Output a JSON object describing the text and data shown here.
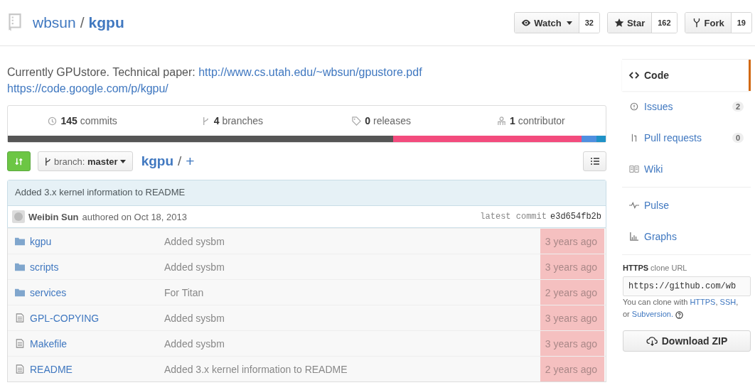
{
  "repo": {
    "owner": "wbsun",
    "separator": "/",
    "name": "kgpu"
  },
  "actions": [
    {
      "kind": "watch",
      "label": "Watch",
      "count": "32"
    },
    {
      "kind": "star",
      "label": "Star",
      "count": "162"
    },
    {
      "kind": "fork",
      "label": "Fork",
      "count": "19"
    }
  ],
  "description": {
    "text": "Currently GPUstore. Technical paper:",
    "link": "http://www.cs.utah.edu/~wbsun/gpustore.pdf",
    "homepage": "https://code.google.com/p/kgpu/"
  },
  "stats": [
    {
      "kind": "commits",
      "count": "145",
      "label": "commits"
    },
    {
      "kind": "branches",
      "count": "4",
      "label": "branches"
    },
    {
      "kind": "releases",
      "count": "0",
      "label": "releases"
    },
    {
      "kind": "contributors",
      "count": "1",
      "label": "contributor"
    }
  ],
  "languages": [
    {
      "color": "#555555"
    },
    {
      "color": "#f34b7d"
    },
    {
      "color": "#4f8fe0"
    },
    {
      "color": "#1f92c7"
    }
  ],
  "toolbar": {
    "branch_label": "branch:",
    "branch": "master",
    "path": "kgpu",
    "path_sep": "/",
    "add": "+"
  },
  "commit": {
    "message": "Added 3.x kernel information to README",
    "author": "Weibin Sun",
    "authored": "authored on Oct 18, 2013",
    "latest_label": "latest commit",
    "sha": "e3d654fb2b"
  },
  "files": {
    "age_highlighted": true,
    "rows": [
      {
        "kind": "folder",
        "name": "kgpu",
        "message": "Added sysbm",
        "age": "3 years ago"
      },
      {
        "kind": "folder",
        "name": "scripts",
        "message": "Added sysbm",
        "age": "3 years ago"
      },
      {
        "kind": "folder",
        "name": "services",
        "message": "For Titan",
        "age": "2 years ago"
      },
      {
        "kind": "file",
        "name": "GPL-COPYING",
        "message": "Added sysbm",
        "age": "3 years ago"
      },
      {
        "kind": "file",
        "name": "Makefile",
        "message": "Added sysbm",
        "age": "3 years ago"
      },
      {
        "kind": "file",
        "name": "README",
        "message": "Added 3.x kernel information to README",
        "age": "2 years ago"
      }
    ]
  },
  "sidebar": {
    "groups": [
      [
        {
          "kind": "code",
          "label": "Code",
          "selected": true
        },
        {
          "kind": "issues",
          "label": "Issues",
          "count": "2",
          "selected": false
        },
        {
          "kind": "pulls",
          "label": "Pull requests",
          "count": "0",
          "selected": false
        },
        {
          "kind": "wiki",
          "label": "Wiki",
          "selected": false
        }
      ],
      [
        {
          "kind": "pulse",
          "label": "Pulse",
          "selected": false
        },
        {
          "kind": "graphs",
          "label": "Graphs",
          "selected": false
        }
      ]
    ]
  },
  "clone": {
    "protocol": "HTTPS",
    "label": "clone URL",
    "value": "https://github.com/wb",
    "note_lines": [
      [
        {
          "kind": "text",
          "text": "You can clone with "
        },
        {
          "kind": "link",
          "text": "HTTPS"
        },
        {
          "kind": "text",
          "text": ", "
        },
        {
          "kind": "link",
          "text": "SSH"
        },
        {
          "kind": "text",
          "text": ","
        }
      ],
      [
        {
          "kind": "text",
          "text": "or "
        },
        {
          "kind": "link",
          "text": "Subversion."
        }
      ]
    ],
    "download": "Download ZIP"
  }
}
